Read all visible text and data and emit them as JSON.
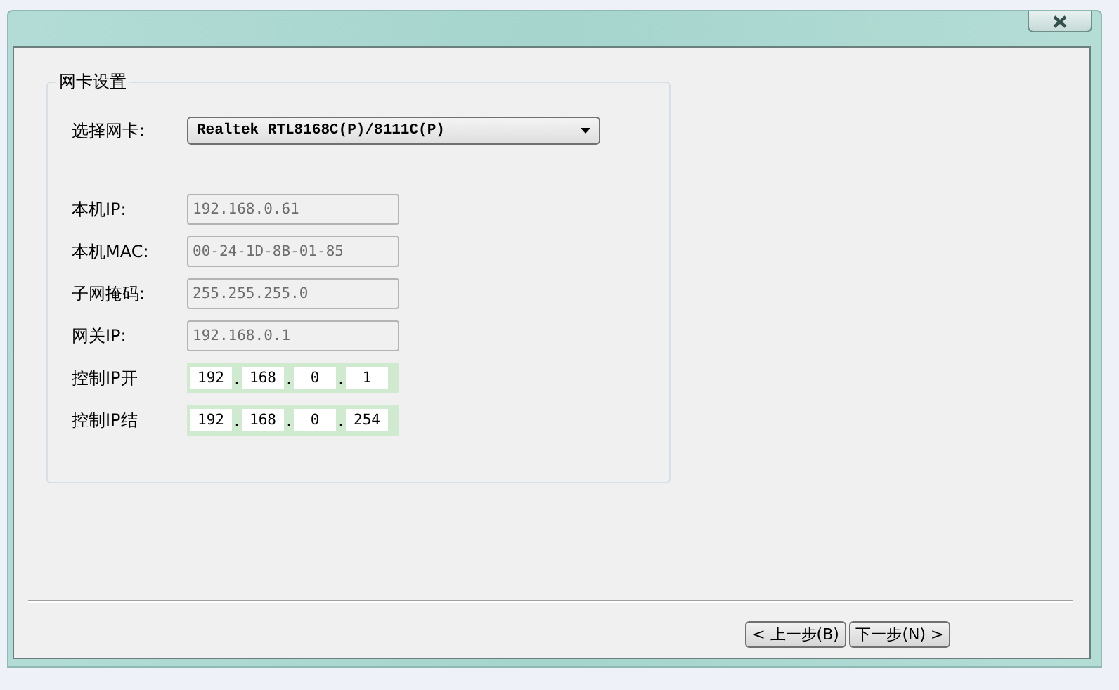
{
  "group": {
    "title": "网卡设置",
    "adapter": {
      "label": "选择网卡:",
      "value": "Realtek RTL8168C(P)/8111C(P)"
    },
    "fields": [
      {
        "label": "本机IP:",
        "value": "192.168.0.61",
        "disabled": true
      },
      {
        "label": "本机MAC:",
        "value": "00-24-1D-8B-01-85",
        "disabled": true
      },
      {
        "label": "子网掩码:",
        "value": "255.255.255.0",
        "disabled": true
      },
      {
        "label": "网关IP:",
        "value": "192.168.0.1",
        "disabled": true
      }
    ],
    "ip_ranges": [
      {
        "label": "控制IP开",
        "separator": ".",
        "octets": [
          "192",
          "168",
          "0",
          "1"
        ]
      },
      {
        "label": "控制IP结",
        "separator": ".",
        "octets": [
          "192",
          "168",
          "0",
          "254"
        ]
      }
    ]
  },
  "buttons": [
    {
      "label": "< 上一步(B)"
    },
    {
      "label": "下一步(N) >"
    }
  ]
}
